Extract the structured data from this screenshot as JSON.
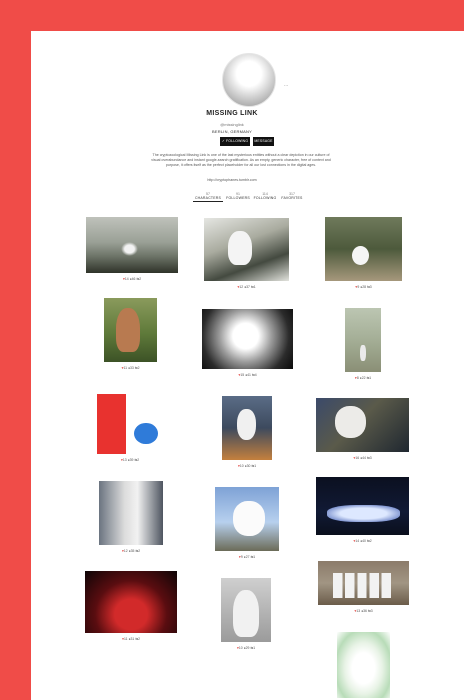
{
  "profile": {
    "name": "MISSING LINK",
    "handle": "@missinglink",
    "location": "BERLIN, GERMANY",
    "follow_label": "✓ FOLLOWING",
    "message_label": "MESSAGE",
    "more_label": "...",
    "bio": "The cryptozoological Missing Link is one of the last mysterious entities without a clear depiction in our culture of visual overabundance and instant google-search gratification. As an empty, generic character, free of context and purpose, it offers itself as the perfect placeholder for all our lost connections in the digital ages.",
    "url": "http://cryptophanes.tumblr.com"
  },
  "tabs": [
    {
      "count": "57",
      "label": "CHARACTERS",
      "active": true
    },
    {
      "count": "91",
      "label": "FOLLOWERS"
    },
    {
      "count": "114",
      "label": "FOLLOWING"
    },
    {
      "count": "317",
      "label": "FAVORITES"
    }
  ],
  "grid": [
    {
      "likes": "14",
      "comments": "46",
      "reposts": "2"
    },
    {
      "likes": "12",
      "comments": "37",
      "reposts": "1"
    },
    {
      "likes": "9",
      "comments": "28",
      "reposts": "3"
    },
    {
      "likes": "11",
      "comments": "33",
      "reposts": "2"
    },
    {
      "likes": "15",
      "comments": "41",
      "reposts": "4"
    },
    {
      "likes": "8",
      "comments": "22",
      "reposts": "1"
    },
    {
      "likes": "13",
      "comments": "39",
      "reposts": "2"
    },
    {
      "likes": "10",
      "comments": "30",
      "reposts": "1"
    },
    {
      "likes": "16",
      "comments": "44",
      "reposts": "3"
    },
    {
      "likes": "12",
      "comments": "35",
      "reposts": "2"
    },
    {
      "likes": "9",
      "comments": "27",
      "reposts": "1"
    },
    {
      "likes": "14",
      "comments": "40",
      "reposts": "2"
    },
    {
      "likes": "11",
      "comments": "31",
      "reposts": "2"
    },
    {
      "likes": "10",
      "comments": "29",
      "reposts": "1"
    },
    {
      "likes": "13",
      "comments": "36",
      "reposts": "3"
    },
    {
      "likes": "",
      "comments": "",
      "reposts": ""
    }
  ],
  "icons": {
    "heart": "heart-icon",
    "comment": "comment-icon",
    "repost": "repost-icon"
  },
  "colors": {
    "frame": "#f04c48",
    "sheet": "#ffffff",
    "button": "#111111",
    "heart": "#e0443f"
  }
}
